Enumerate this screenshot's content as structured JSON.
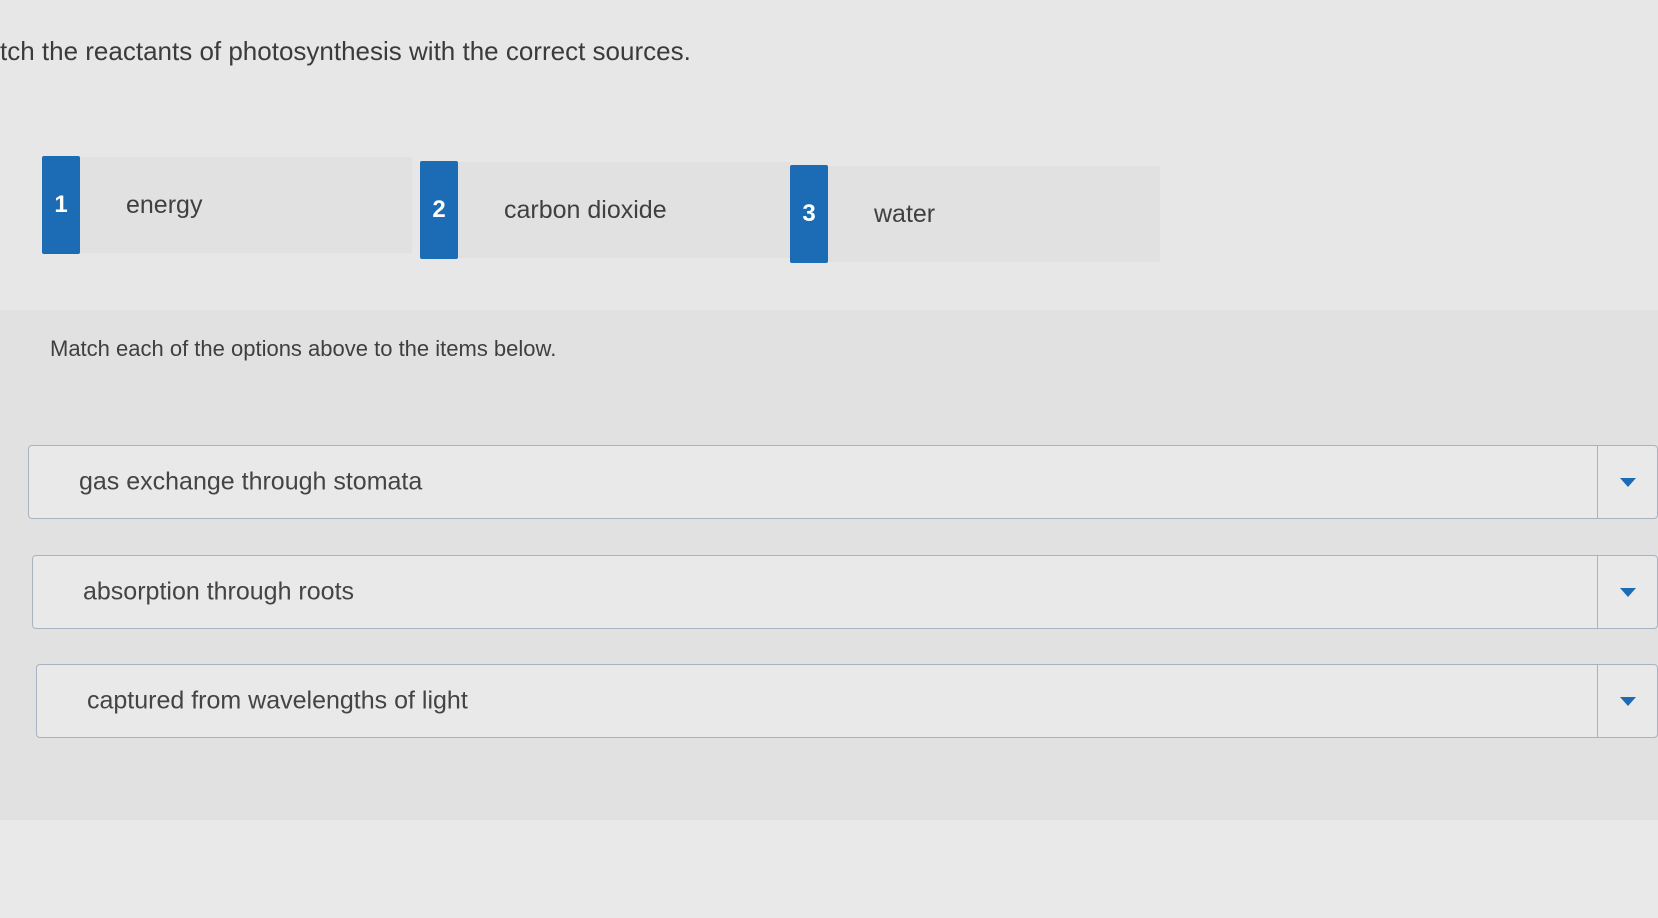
{
  "question": {
    "text": "tch the reactants of photosynthesis with the correct sources."
  },
  "options": [
    {
      "number": "1",
      "label": "energy"
    },
    {
      "number": "2",
      "label": "carbon dioxide"
    },
    {
      "number": "3",
      "label": "water"
    }
  ],
  "instructions": "Match each of the options above to the items below.",
  "items": [
    {
      "text": "gas exchange through stomata",
      "dropdown_icon": "chevron-down-icon"
    },
    {
      "text": "absorption through roots",
      "dropdown_icon": "chevron-down-icon"
    },
    {
      "text": "captured from wavelengths of light",
      "dropdown_icon": "chevron-down-icon"
    }
  ],
  "colors": {
    "accent": "#1b6bb5",
    "background": "#e7e7e7",
    "border": "#a9b3bf"
  }
}
